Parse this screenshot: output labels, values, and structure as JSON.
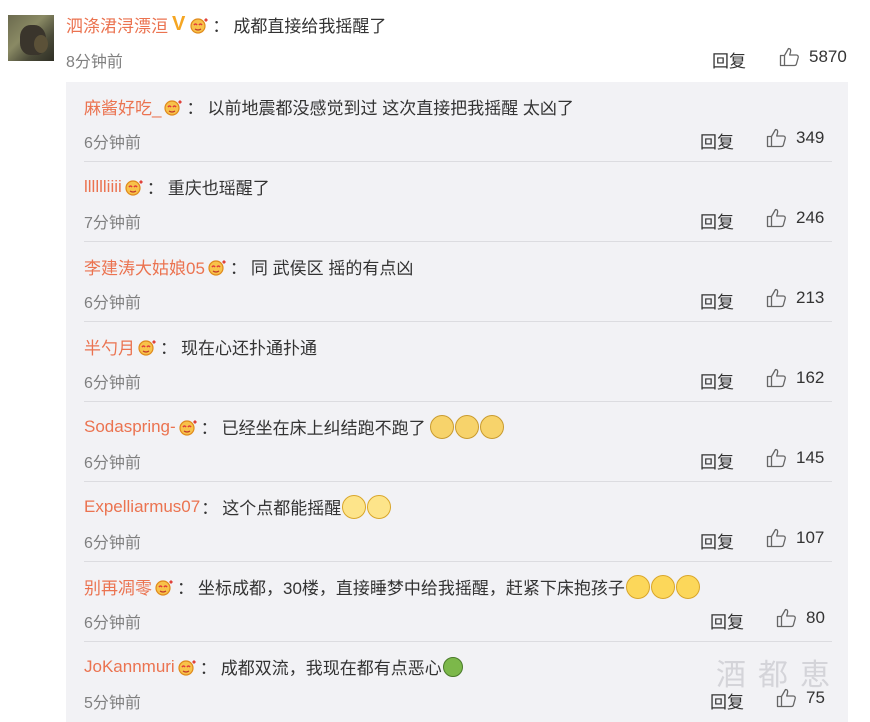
{
  "main_comment": {
    "username": "泗涤涒浔漂洹",
    "text": "成都直接给我摇醒了",
    "time": "8分钟前",
    "reply_label": "回复",
    "likes": "5870"
  },
  "replies": [
    {
      "username": "麻酱好吃_",
      "text": "以前地震都没感觉到过 这次直接把我摇醒 太凶了",
      "time": "6分钟前",
      "reply_label": "回复",
      "likes": "349"
    },
    {
      "username": "lllllliiii",
      "text": "重庆也瑶醒了",
      "time": "7分钟前",
      "reply_label": "回复",
      "likes": "246"
    },
    {
      "username": "李建涛大姑娘05",
      "text": "同 武侯区 摇的有点凶",
      "time": "6分钟前",
      "reply_label": "回复",
      "likes": "213"
    },
    {
      "username": "半勺月",
      "text": "现在心还扑通扑通",
      "time": "6分钟前",
      "reply_label": "回复",
      "likes": "162"
    },
    {
      "username": "Sodaspring-",
      "text": "已经坐在床上纠结跑不跑了",
      "time": "6分钟前",
      "reply_label": "回复",
      "likes": "145"
    },
    {
      "username": "Expelliarmus07",
      "text": "这个点都能摇醒",
      "time": "6分钟前",
      "reply_label": "回复",
      "likes": "107"
    },
    {
      "username": "别再凋零",
      "text": "坐标成都，30楼，直接睡梦中给我摇醒，赶紧下床抱孩子",
      "time": "6分钟前",
      "reply_label": "回复",
      "likes": "80"
    },
    {
      "username": "JoKannmuri",
      "text": "成都双流，我现在都有点恶心",
      "time": "5分钟前",
      "reply_label": "回复",
      "likes": "75"
    }
  ],
  "watermark": "酒都恵",
  "colors": {
    "username": "#eb7350",
    "sub_bg": "#f2f2f5",
    "time": "#808080"
  }
}
